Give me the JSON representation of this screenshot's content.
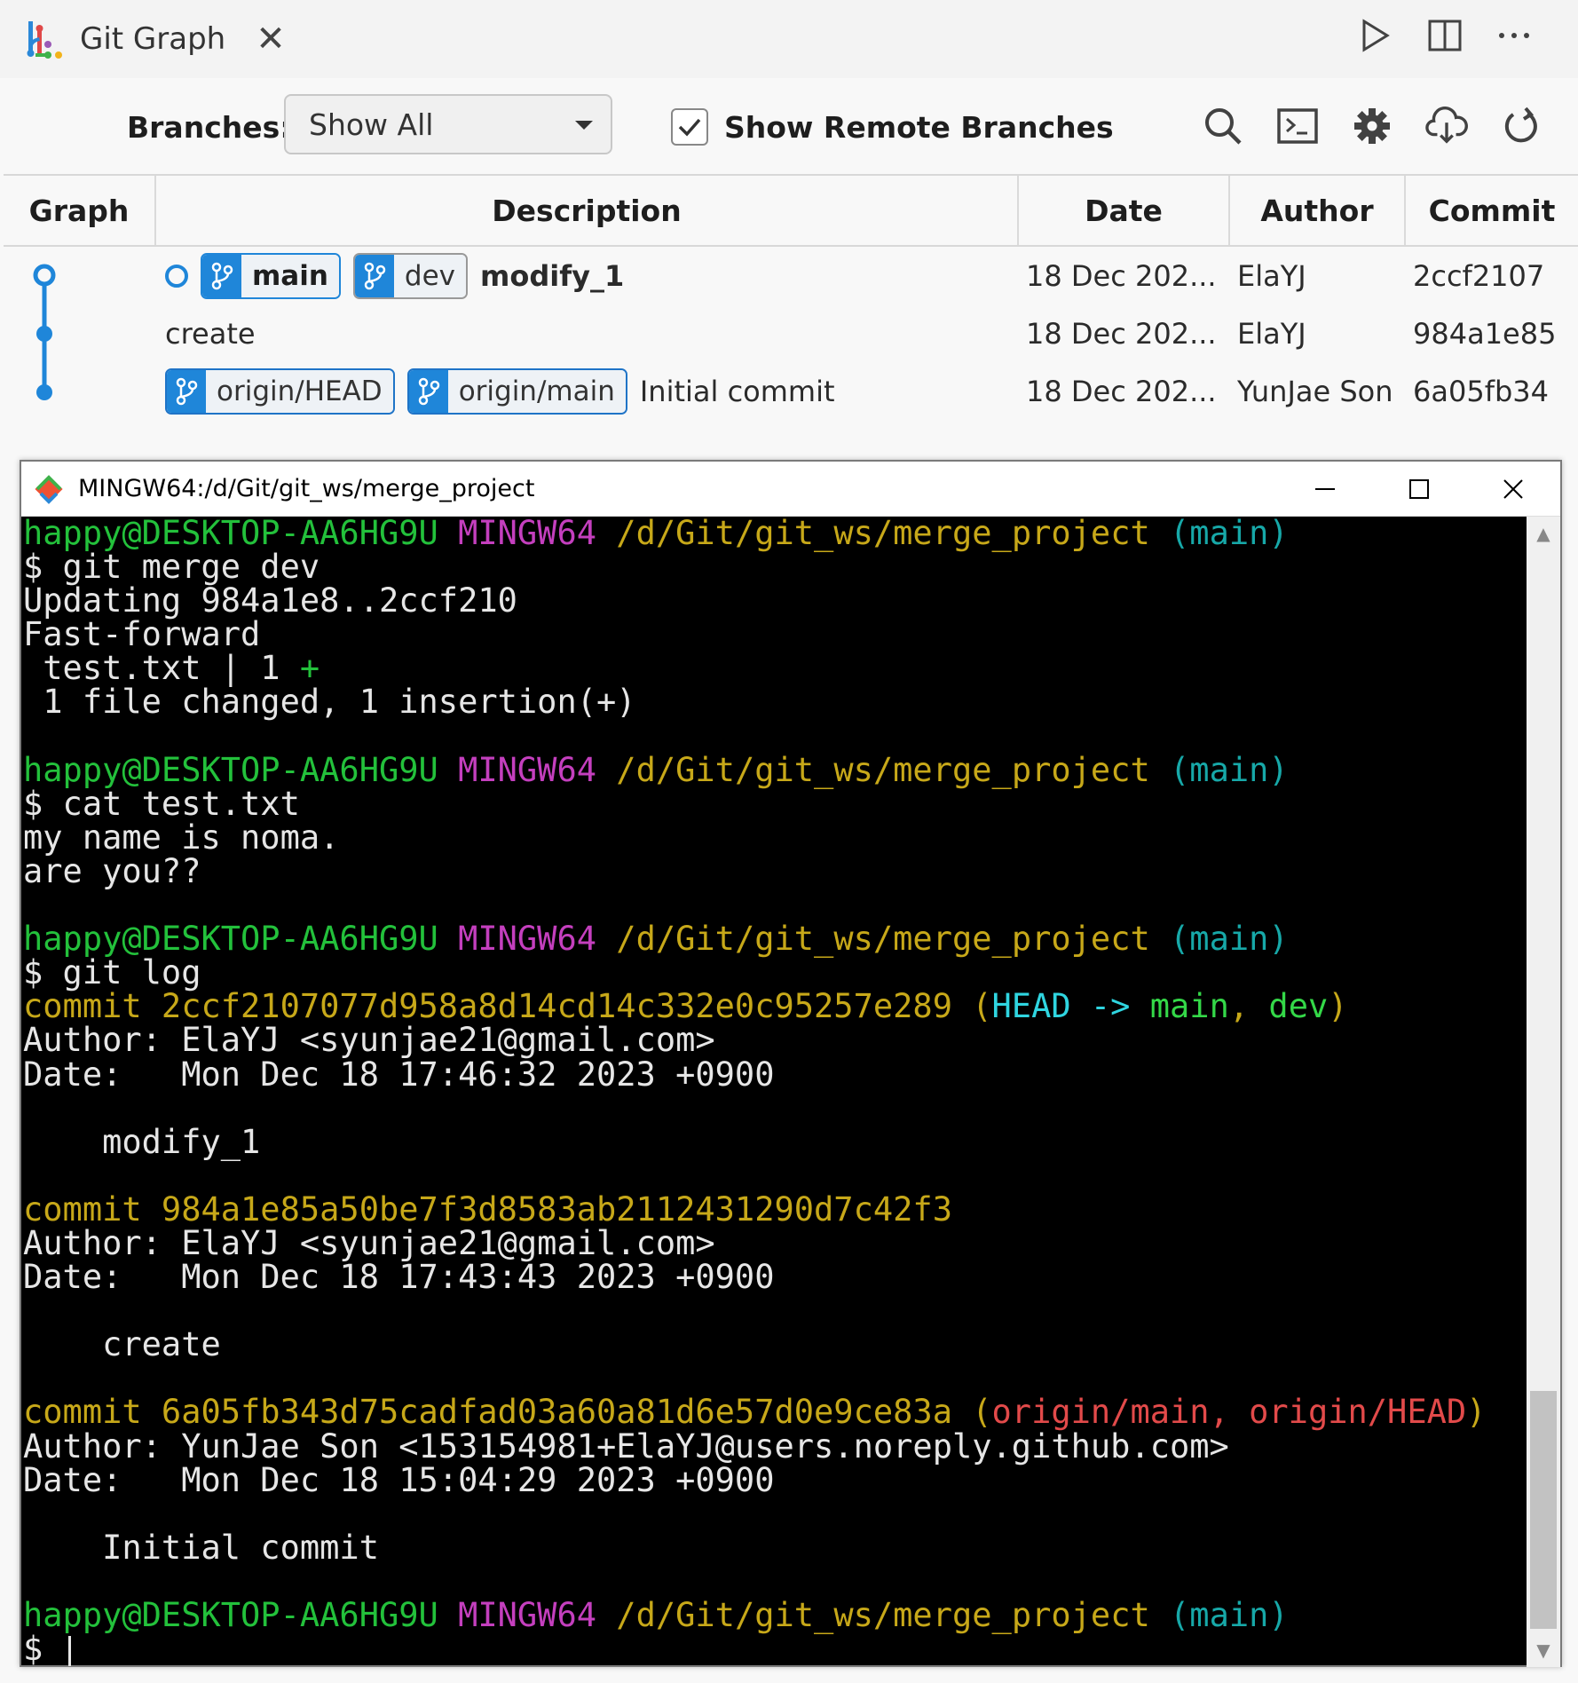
{
  "tab": {
    "title": "Git Graph",
    "close": "✕"
  },
  "controls": {
    "branches_label": "Branches:",
    "branches_value": "Show All",
    "show_remote_label": "Show Remote Branches",
    "show_remote_checked": true
  },
  "table": {
    "headers": {
      "graph": "Graph",
      "description": "Description",
      "date": "Date",
      "author": "Author",
      "commit": "Commit"
    },
    "rows": [
      {
        "refs": [
          "main",
          "dev"
        ],
        "message": "modify_1",
        "date": "18 Dec 202...",
        "author": "ElaYJ",
        "commit": "2ccf2107"
      },
      {
        "refs": [],
        "message": "create",
        "date": "18 Dec 202...",
        "author": "ElaYJ",
        "commit": "984a1e85"
      },
      {
        "refs": [
          "origin/HEAD",
          "origin/main"
        ],
        "message": "Initial commit",
        "date": "18 Dec 202...",
        "author": "YunJae Son",
        "commit": "6a05fb34"
      }
    ]
  },
  "terminal": {
    "title": "MINGW64:/d/Git/git_ws/merge_project",
    "prompt": {
      "user": "happy@DESKTOP-AA6HG9U",
      "system": "MINGW64",
      "path": "/d/Git/git_ws/merge_project",
      "branch": "(main)"
    },
    "lines": {
      "cmd1": "$ git merge dev",
      "out1a": "Updating 984a1e8..2ccf210",
      "out1b": "Fast-forward",
      "out1c": " test.txt | 1 ",
      "out1c_plus": "+",
      "out1d": " 1 file changed, 1 insertion(+)",
      "cmd2": "$ cat test.txt",
      "out2a": "my name is noma.",
      "out2b": "are you??",
      "cmd3": "$ git log",
      "c1_hash": "commit 2ccf2107077d958a8d14cd14c332e0c95257e289",
      "c1_open": " (",
      "c1_head": "HEAD -> ",
      "c1_main": "main",
      "c1_comma": ", ",
      "c1_dev": "dev",
      "c1_close": ")",
      "c1_author": "Author: ElaYJ <syunjae21@gmail.com>",
      "c1_date": "Date:   Mon Dec 18 17:46:32 2023 +0900",
      "c1_msg": "    modify_1",
      "c2_hash": "commit 984a1e85a50be7f3d8583ab2112431290d7c42f3",
      "c2_author": "Author: ElaYJ <syunjae21@gmail.com>",
      "c2_date": "Date:   Mon Dec 18 17:43:43 2023 +0900",
      "c2_msg": "    create",
      "c3_hash": "commit 6a05fb343d75cadfad03a60a81d6e57d0e9ce83a",
      "c3_open": " (",
      "c3_refs": "origin/main, origin/HEAD",
      "c3_close": ")",
      "c3_author": "Author: YunJae Son <153154981+ElaYJ@users.noreply.github.com>",
      "c3_date": "Date:   Mon Dec 18 15:04:29 2023 +0900",
      "c3_msg": "    Initial commit",
      "final_prompt": "$ "
    }
  },
  "colors": {
    "accent": "#1f86d9",
    "terminal_bg": "#000000",
    "prompt_user": "#23c13b",
    "prompt_system": "#c43fbe",
    "prompt_path": "#c7a819",
    "prompt_branch": "#17a8a8"
  }
}
